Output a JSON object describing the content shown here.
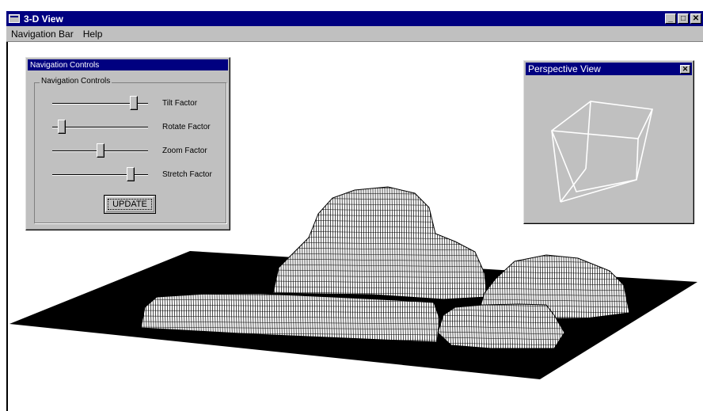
{
  "window": {
    "title": "3-D View",
    "minimize_glyph": "_",
    "maximize_glyph": "□",
    "close_glyph": "✕"
  },
  "menu": {
    "items": [
      {
        "label": "Navigation Bar"
      },
      {
        "label": "Help"
      }
    ]
  },
  "nav_controls": {
    "window_title": "Navigation Controls",
    "group_label": "Navigation Controls",
    "sliders": [
      {
        "label": "Tilt Factor",
        "value": 0.85
      },
      {
        "label": "Rotate Factor",
        "value": 0.1
      },
      {
        "label": "Zoom Factor",
        "value": 0.5
      },
      {
        "label": "Stretch Factor",
        "value": 0.82
      }
    ],
    "update_label": "UPDATE"
  },
  "perspective": {
    "title": "Perspective  View",
    "close_glyph": "✕"
  },
  "colors": {
    "title_bar": "#000080",
    "face": "#c0c0c0",
    "terrain_fill": "#ffffff",
    "terrain_line": "#000000",
    "ground": "#000000"
  }
}
